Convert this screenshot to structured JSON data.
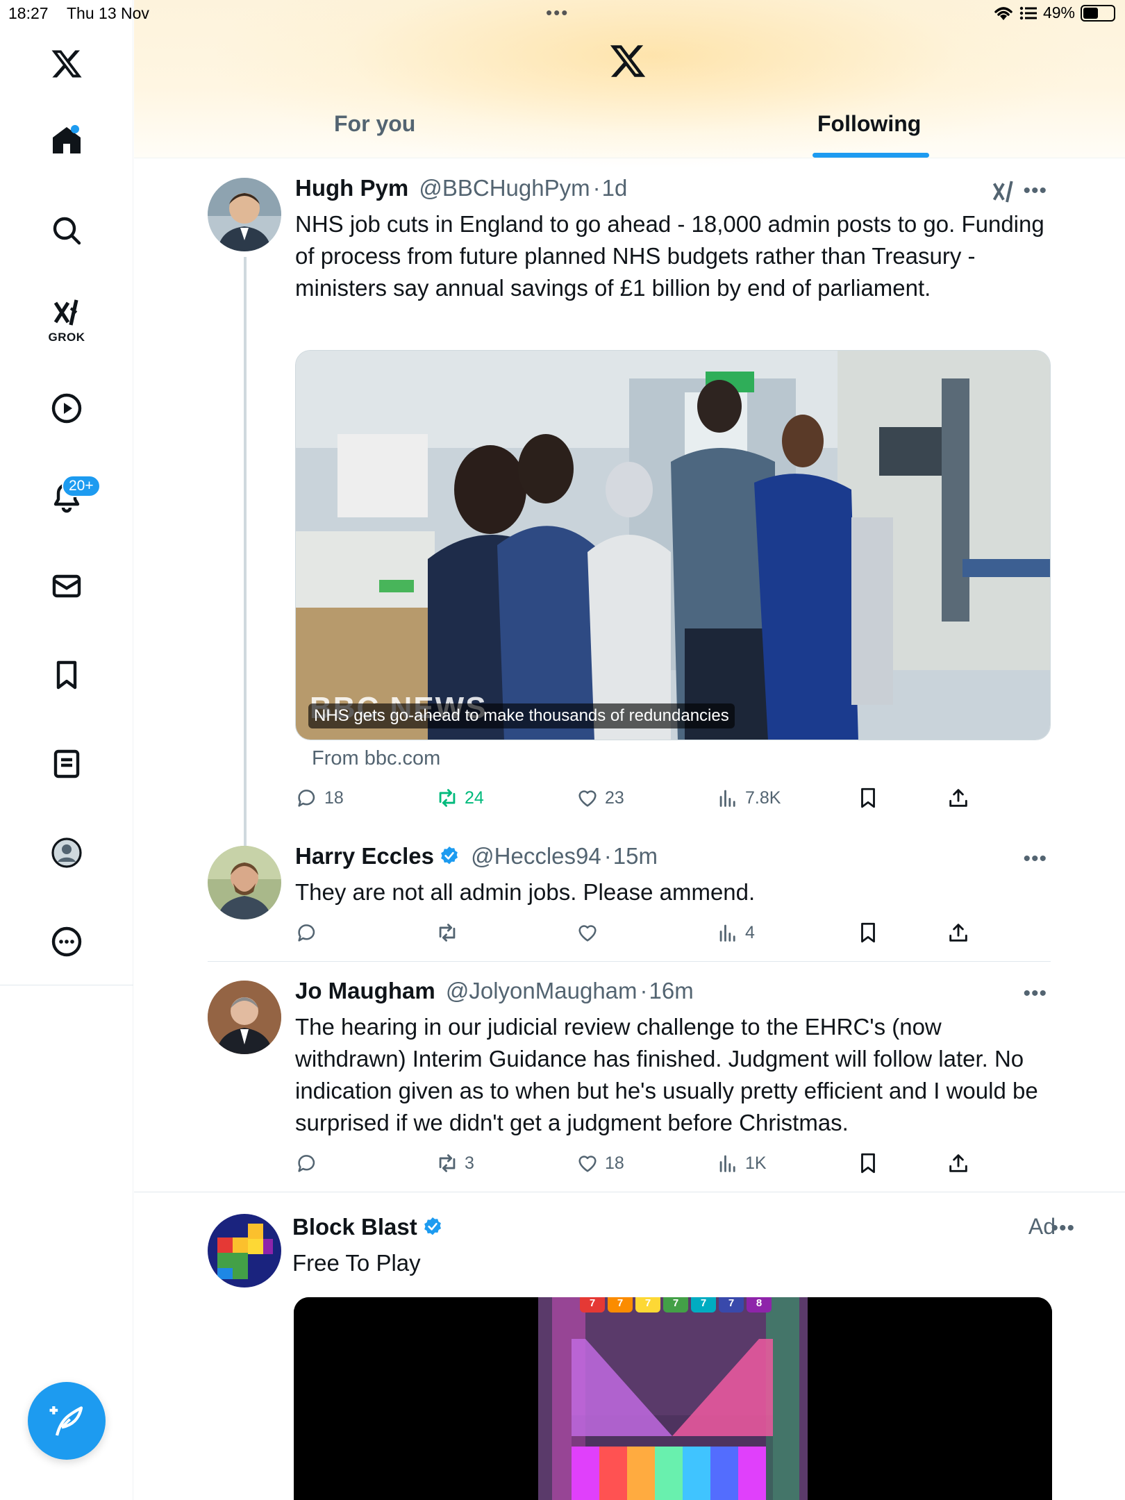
{
  "status_bar": {
    "time": "18:27",
    "date": "Thu 13 Nov",
    "battery_text": "49%",
    "battery_level": 0.49
  },
  "sidebar": {
    "items": [
      {
        "icon": "x-logo-icon"
      },
      {
        "icon": "home-icon",
        "active": true
      },
      {
        "icon": "search-icon"
      },
      {
        "icon": "grok-icon",
        "label": "GROK"
      },
      {
        "icon": "video-play-icon"
      },
      {
        "icon": "bell-icon",
        "badge": "20+"
      },
      {
        "icon": "mail-icon"
      },
      {
        "icon": "bookmark-icon"
      },
      {
        "icon": "lists-icon"
      },
      {
        "icon": "profile-icon"
      },
      {
        "icon": "more-icon"
      }
    ],
    "compose_icon": "compose-feather-icon"
  },
  "header": {
    "logo_icon": "x-logo-icon",
    "tabs": [
      {
        "label": "For you",
        "active": false
      },
      {
        "label": "Following",
        "active": true
      }
    ]
  },
  "feed": {
    "posts": [
      {
        "name": "Hugh Pym",
        "handle": "@BBCHughPym",
        "sep": "·",
        "time": "1d",
        "text": "NHS job cuts in England to go ahead - 18,000 admin posts to go. Funding of process from future planned NHS budgets rather than Treasury - ministers say annual savings of £1 billion by end of parliament.",
        "card": {
          "caption": "NHS gets go-ahead to make thousands of redundancies",
          "watermark": "BBC NEWS",
          "source": "From bbc.com"
        },
        "stats": {
          "replies": "18",
          "reposts": "24",
          "likes": "23",
          "views": "7.8K"
        }
      },
      {
        "name": "Harry Eccles",
        "handle": "@Heccles94",
        "sep": "·",
        "time": "15m",
        "verified": true,
        "text": "They are not all admin jobs. Please ammend.",
        "stats": {
          "replies": "",
          "reposts": "",
          "likes": "",
          "views": "4"
        }
      },
      {
        "name": "Jo Maugham",
        "handle": "@JolyonMaugham",
        "sep": "·",
        "time": "16m",
        "text": "The hearing in our judicial review challenge to the EHRC's (now withdrawn) Interim Guidance has finished. Judgment will follow later. No indication given as to when but he's usually pretty efficient and I would be surprised if we didn't get a judgment before Christmas.",
        "stats": {
          "replies": "",
          "reposts": "3",
          "likes": "18",
          "views": "1K"
        }
      }
    ],
    "ad": {
      "name": "Block Blast",
      "verified": true,
      "tagline": "Free To Play",
      "label": "Ad",
      "media_numbers": [
        "7",
        "7",
        "7",
        "7",
        "7",
        "7",
        "8"
      ]
    }
  },
  "colors": {
    "accent": "#1d9bf0",
    "text_primary": "#0f1419",
    "text_secondary": "#536471",
    "repost_active": "#00ba7c"
  }
}
